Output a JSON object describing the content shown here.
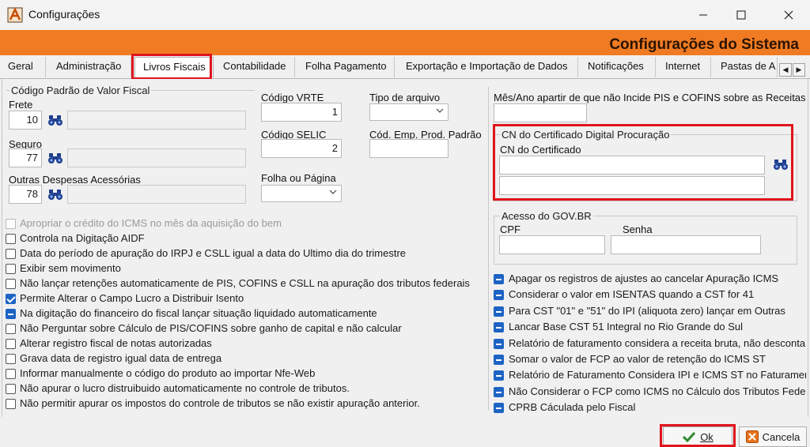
{
  "window": {
    "title": "Configurações"
  },
  "banner": {
    "title": "Configurações do Sistema"
  },
  "tabs": [
    {
      "label": "Geral"
    },
    {
      "label": "Administração"
    },
    {
      "label": "Livros Fiscais"
    },
    {
      "label": "Contabilidade"
    },
    {
      "label": "Folha Pagamento"
    },
    {
      "label": "Exportação e Importação de Dados"
    },
    {
      "label": "Notificações"
    },
    {
      "label": "Internet"
    },
    {
      "label": "Pastas de A"
    }
  ],
  "left": {
    "group_title": "Código Padrão de Valor Fiscal",
    "frete": {
      "label": "Frete",
      "value": "10"
    },
    "seguro": {
      "label": "Seguro",
      "value": "77"
    },
    "outras": {
      "label": "Outras Despesas Acessórias",
      "value": "78"
    }
  },
  "middle": {
    "vrte": {
      "label": "Código VRTE",
      "value": "1"
    },
    "selic": {
      "label": "Código SELIC",
      "value": "2"
    },
    "folha": {
      "label": "Folha ou Página"
    },
    "tipo": {
      "label": "Tipo de arquivo"
    },
    "cod_emp": {
      "label": "Cód. Emp. Prod. Padrão"
    }
  },
  "right": {
    "mes_ano_label": "Mês/Ano apartir de que não Incide PIS e COFINS sobre as Receitas",
    "cert_group_title": "CN do Certificado Digital Procuração",
    "cert_label": "CN do Certificado",
    "gov_group_title": "Acesso do GOV.BR",
    "cpf_label": "CPF",
    "senha_label": "Senha"
  },
  "left_checks": [
    {
      "label": "Apropriar o crédito do ICMS no mês da aquisição do bem",
      "state": "disabled"
    },
    {
      "label": "Controla na Digitação AIDF",
      "state": "unchecked"
    },
    {
      "label": "Data do período de apuração do IRPJ e CSLL igual a data do Ultimo dia do trimestre",
      "state": "unchecked"
    },
    {
      "label": "Exibir sem movimento",
      "state": "unchecked"
    },
    {
      "label": "Não lançar retenções automaticamente de PIS, COFINS e CSLL na apuração dos tributos federais",
      "state": "unchecked"
    },
    {
      "label": "Permite Alterar o Campo Lucro a Distribuir Isento",
      "state": "checked"
    },
    {
      "label": "Na digitação do financeiro do fiscal lançar situação liquidado automaticamente",
      "state": "indeterminate"
    },
    {
      "label": "Não Perguntar sobre Cálculo de PIS/COFINS sobre ganho de capital e não calcular",
      "state": "unchecked"
    },
    {
      "label": "Alterar registro fiscal de notas autorizadas",
      "state": "unchecked"
    },
    {
      "label": "Grava data de registro igual data de entrega",
      "state": "unchecked"
    },
    {
      "label": "Informar manualmente o código do produto ao importar Nfe-Web",
      "state": "unchecked"
    },
    {
      "label": "Não apurar o lucro distruibuido automaticamente no controle de tributos.",
      "state": "unchecked"
    },
    {
      "label": "Não permitir apurar os impostos do controle de tributos se não existir apuração anterior.",
      "state": "unchecked"
    }
  ],
  "right_checks": [
    {
      "label": "Apagar os registros de ajustes ao cancelar Apuração ICMS"
    },
    {
      "label": "Considerar o valor em ISENTAS quando a CST for 41"
    },
    {
      "label": "Para CST \"01\" e \"51\" do IPI (aliquota zero) lançar em Outras"
    },
    {
      "label": "Lancar Base CST 51 Integral no Rio Grande do Sul"
    },
    {
      "label": "Relatório de faturamento considera a receita bruta, não descontar"
    },
    {
      "label": "Somar o valor de FCP ao valor de retenção do ICMS ST"
    },
    {
      "label": "Relatório de Faturamento Considera IPI e ICMS ST no Faturament"
    },
    {
      "label": "Não Considerar o FCP como ICMS no Cálculo dos Tributos Federa"
    },
    {
      "label": "CPRB Cáculada pelo Fiscal"
    }
  ],
  "footer": {
    "ok_label": "Ok",
    "cancel_label": "Cancela"
  },
  "colors": {
    "banner": "#f07b23",
    "highlight": "#e0141c",
    "check": "#1d63c4"
  }
}
